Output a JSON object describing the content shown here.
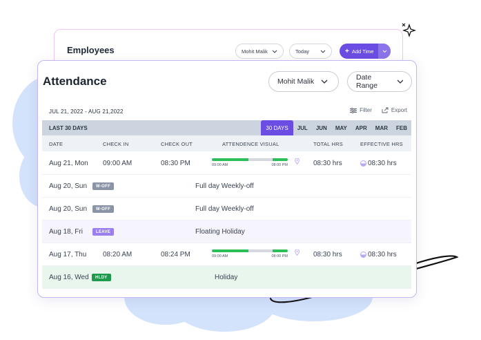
{
  "back_card": {
    "title": "Employees",
    "employee_select": "Mohit Malik",
    "date_select": "Today",
    "add_time_label": "Add Time"
  },
  "attendance": {
    "title": "Attendance",
    "employee_select": "Mohit Malik",
    "range_select": "Date Range",
    "date_range": "JUL 21, 2022 - AUG 21,2022",
    "filter_label": "Filter",
    "export_label": "Export",
    "period_label": "LAST 30 DAYS",
    "months": [
      "30 DAYS",
      "JUL",
      "JUN",
      "MAY",
      "APR",
      "MAR",
      "FEB"
    ],
    "active_month": "30 DAYS",
    "columns": {
      "date": "DATE",
      "check_in": "CHECK IN",
      "check_out": "CHECK OUT",
      "visual": "ATTENDENCE VISUAL",
      "total": "TOTAL HRS",
      "effective": "EFFECTIVE HRS"
    },
    "rows": [
      {
        "date": "Aug 21, Mon",
        "check_in": "09:00 AM",
        "check_out": "08:30 PM",
        "vis_start": "09:00 AM",
        "vis_end": "08:00 PM",
        "total": "08:30 hrs",
        "effective": "08:30 hrs"
      },
      {
        "date": "Aug 20, Sun",
        "badge": "W-OFF",
        "note": "Full day Weekly-off"
      },
      {
        "date": "Aug 20, Sun",
        "badge": "W-OFF",
        "note": "Full day Weekly-off"
      },
      {
        "date": "Aug 18, Fri",
        "badge": "LEAVE",
        "note": "Floating Holiday"
      },
      {
        "date": "Aug 17, Thu",
        "check_in": "08:20 AM",
        "check_out": "08:24 PM",
        "vis_start": "09:00 AM",
        "vis_end": "08:00 PM",
        "total": "08:30 hrs",
        "effective": "08:30 hrs"
      },
      {
        "date": "Aug 16, Wed",
        "badge": "HLDY",
        "note": "Holiday"
      }
    ]
  },
  "colors": {
    "accent": "#6c4de3",
    "worked": "#2bbf5a",
    "break": "#d5d8de",
    "woff": "#8a94a6",
    "leave": "#9b7ff0",
    "holiday": "#1f9a4c",
    "holiday_row": "#e8f6ee",
    "leave_row": "#f6f4fc"
  }
}
